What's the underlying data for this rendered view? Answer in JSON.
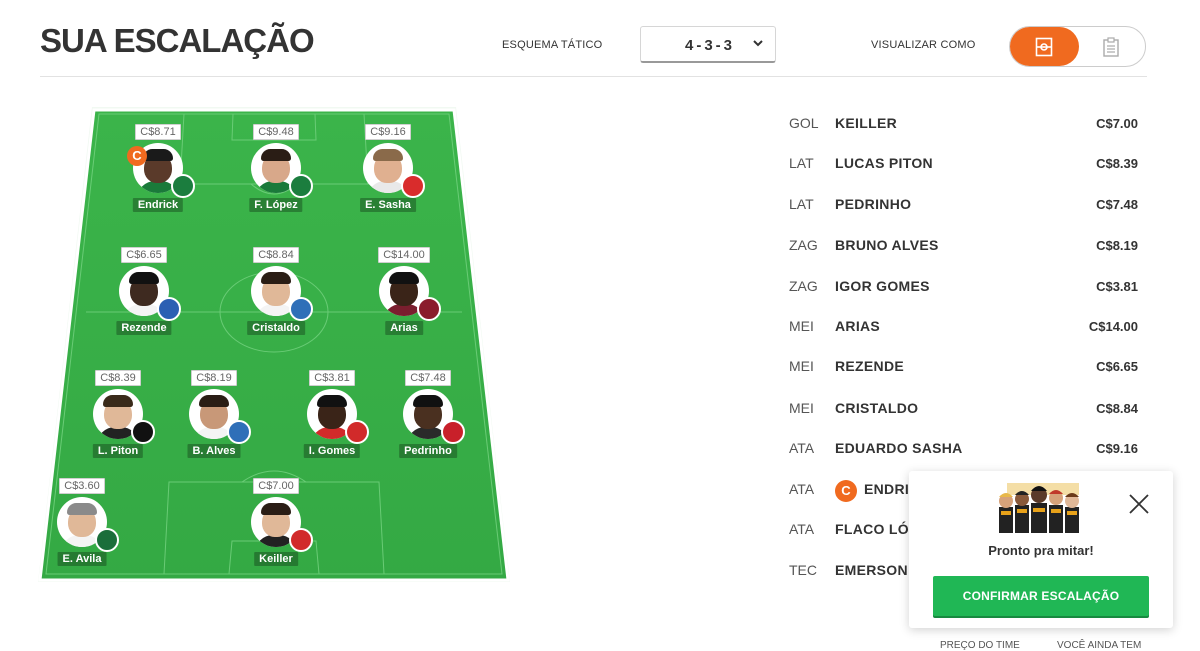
{
  "header": {
    "title": "SUA ESCALAÇÃO",
    "scheme_label": "ESQUEMA TÁTICO",
    "formation": "4-3-3",
    "view_label": "VISUALIZAR COMO"
  },
  "field_players": [
    {
      "name": "Endrick",
      "price": "C$8.71",
      "captain_label": "C"
    },
    {
      "name": "F. López",
      "price": "C$9.48"
    },
    {
      "name": "E. Sasha",
      "price": "C$9.16"
    },
    {
      "name": "Rezende",
      "price": "C$6.65"
    },
    {
      "name": "Cristaldo",
      "price": "C$8.84"
    },
    {
      "name": "Arias",
      "price": "C$14.00"
    },
    {
      "name": "L. Piton",
      "price": "C$8.39"
    },
    {
      "name": "B. Alves",
      "price": "C$8.19"
    },
    {
      "name": "I. Gomes",
      "price": "C$3.81"
    },
    {
      "name": "Pedrinho",
      "price": "C$7.48"
    },
    {
      "name": "E. Avila",
      "price": "C$3.60"
    },
    {
      "name": "Keiller",
      "price": "C$7.00"
    }
  ],
  "list": [
    {
      "pos": "GOL",
      "name": "KEILLER",
      "price": "C$7.00"
    },
    {
      "pos": "LAT",
      "name": "LUCAS PITON",
      "price": "C$8.39"
    },
    {
      "pos": "LAT",
      "name": "PEDRINHO",
      "price": "C$7.48"
    },
    {
      "pos": "ZAG",
      "name": "BRUNO ALVES",
      "price": "C$8.19"
    },
    {
      "pos": "ZAG",
      "name": "IGOR GOMES",
      "price": "C$3.81"
    },
    {
      "pos": "MEI",
      "name": "ARIAS",
      "price": "C$14.00"
    },
    {
      "pos": "MEI",
      "name": "REZENDE",
      "price": "C$6.65"
    },
    {
      "pos": "MEI",
      "name": "CRISTALDO",
      "price": "C$8.84"
    },
    {
      "pos": "ATA",
      "name": "EDUARDO SASHA",
      "price": "C$9.16"
    },
    {
      "pos": "ATA",
      "name": "ENDRIC",
      "price": "",
      "captain_label": "C"
    },
    {
      "pos": "ATA",
      "name": "FLACO LÓP",
      "price": ""
    },
    {
      "pos": "TEC",
      "name": "EMERSON A",
      "price": ""
    }
  ],
  "popup": {
    "message": "Pronto pra mitar!",
    "confirm_label": "CONFIRMAR ESCALAÇÃO"
  },
  "footer": {
    "team_price_label": "PREÇO DO TIME",
    "remaining_label": "VOCÊ AINDA TEM"
  },
  "colors": {
    "accent": "#f06a1f",
    "field": "#3cb34a",
    "confirm": "#20b755"
  }
}
